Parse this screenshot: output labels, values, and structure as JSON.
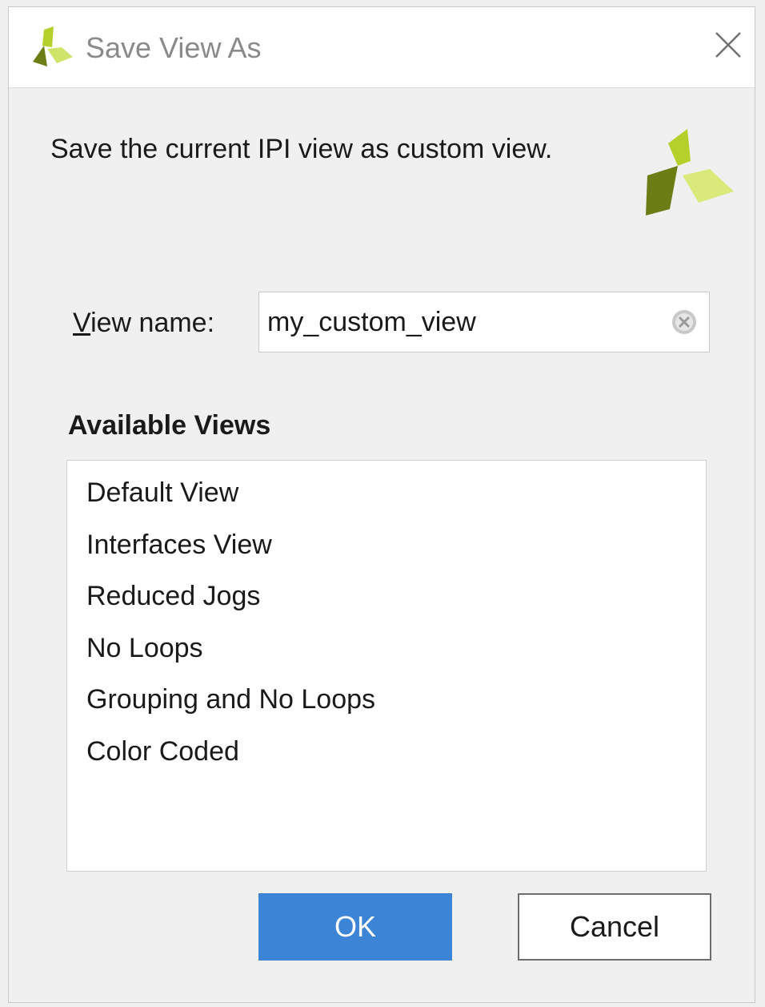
{
  "dialog": {
    "title": "Save View As",
    "description": "Save the current IPI view as custom view.",
    "brand_colors": {
      "logo_dark": "#6b7d14",
      "logo_mid": "#b5cf2b",
      "logo_light": "#d9ea7a"
    }
  },
  "form": {
    "view_name_label_mnemonic": "V",
    "view_name_label_rest": "iew name:",
    "view_name_value": "my_custom_view"
  },
  "available_views": {
    "title": "Available Views",
    "items": [
      "Default View",
      "Interfaces View",
      "Reduced Jogs",
      "No Loops",
      "Grouping and No Loops",
      "Color Coded"
    ]
  },
  "buttons": {
    "ok_label": "OK",
    "cancel_label": "Cancel",
    "ok_color": "#3c84d6"
  },
  "icons": {
    "title": "xilinx-logo-icon",
    "close": "close-icon",
    "header": "xilinx-logo-icon",
    "clear": "clear-field-icon"
  }
}
